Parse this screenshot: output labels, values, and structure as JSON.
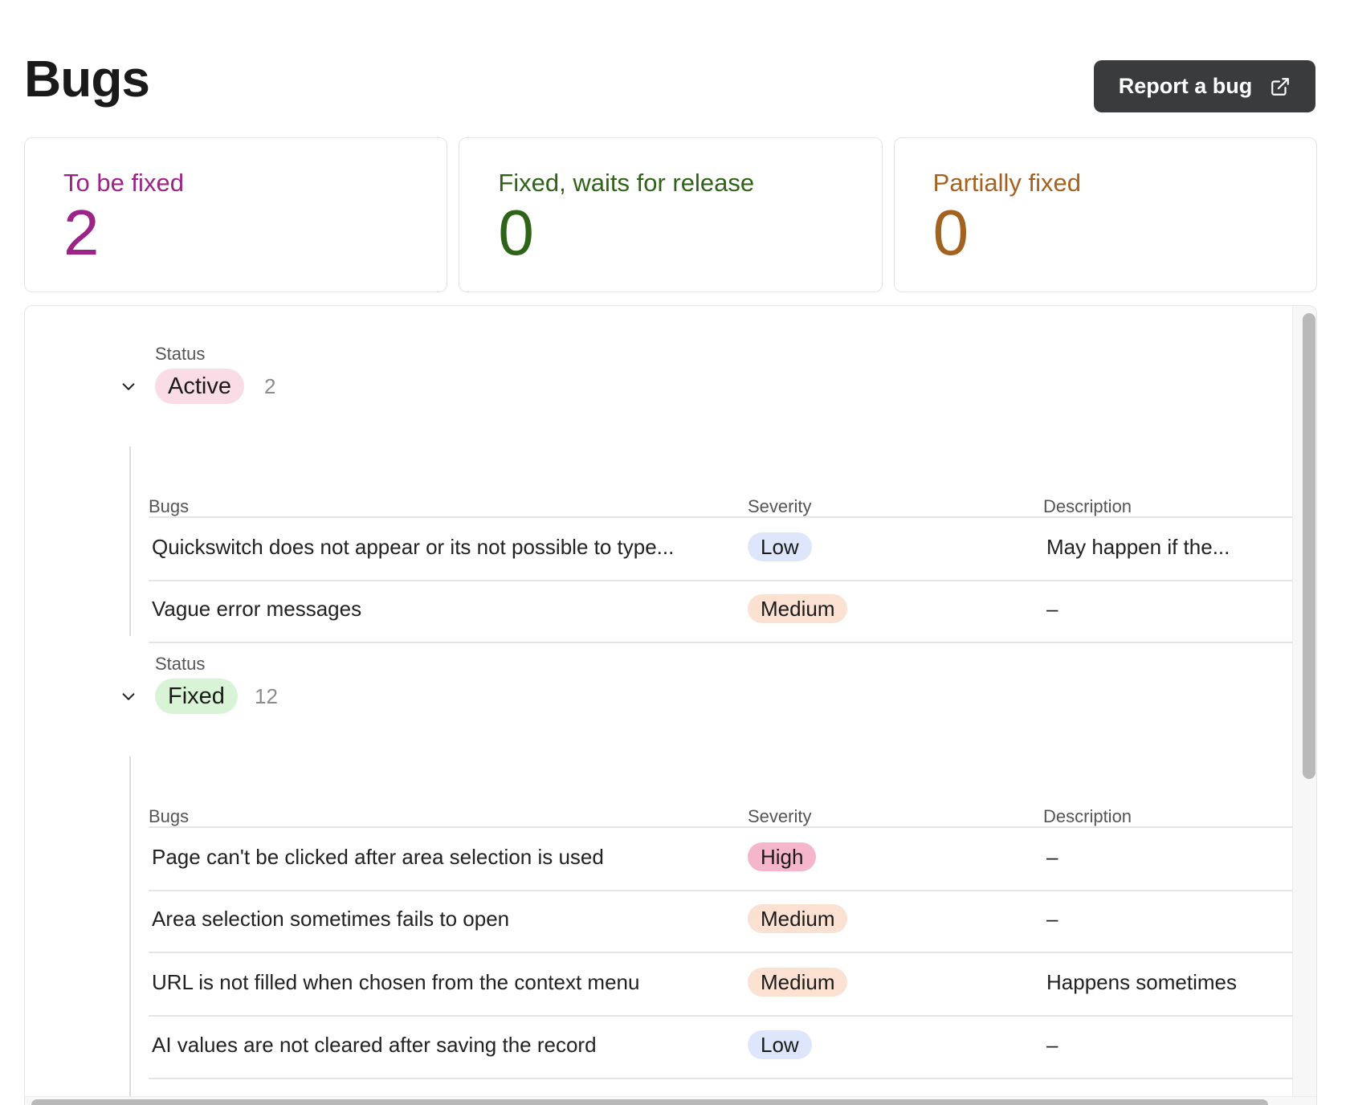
{
  "page": {
    "title": "Bugs"
  },
  "report_button": {
    "label": "Report a bug",
    "icon": "external-link-icon"
  },
  "stats": [
    {
      "label": "To be fixed",
      "value": "2",
      "color": "#9c2487"
    },
    {
      "label": "Fixed, waits for release",
      "value": "0",
      "color": "#2e6318"
    },
    {
      "label": "Partially fixed",
      "value": "0",
      "color": "#a4621f"
    }
  ],
  "groups": [
    {
      "status_label": "Status",
      "status": "Active",
      "count": "2",
      "pill_color": "#fadce6",
      "columns": [
        "Bugs",
        "Severity",
        "Description"
      ],
      "rows": [
        {
          "title": "Quickswitch does not appear or its not possible to type...",
          "severity": "Low",
          "description": "May happen if the..."
        },
        {
          "title": "Vague error messages",
          "severity": "Medium",
          "description": "–"
        }
      ]
    },
    {
      "status_label": "Status",
      "status": "Fixed",
      "count": "12",
      "pill_color": "#d9f3d6",
      "columns": [
        "Bugs",
        "Severity",
        "Description"
      ],
      "rows": [
        {
          "title": "Page can't be clicked after area selection is used",
          "severity": "High",
          "description": "–"
        },
        {
          "title": "Area selection sometimes fails to open",
          "severity": "Medium",
          "description": "–"
        },
        {
          "title": "URL is not filled when chosen from the context menu",
          "severity": "Medium",
          "description": "Happens sometimes"
        },
        {
          "title": "AI values are not cleared after saving the record",
          "severity": "Low",
          "description": "–"
        }
      ]
    }
  ],
  "severity_colors": {
    "Low": "#dde6fb",
    "Medium": "#fbe1d2",
    "High": "#f5b6cb"
  }
}
